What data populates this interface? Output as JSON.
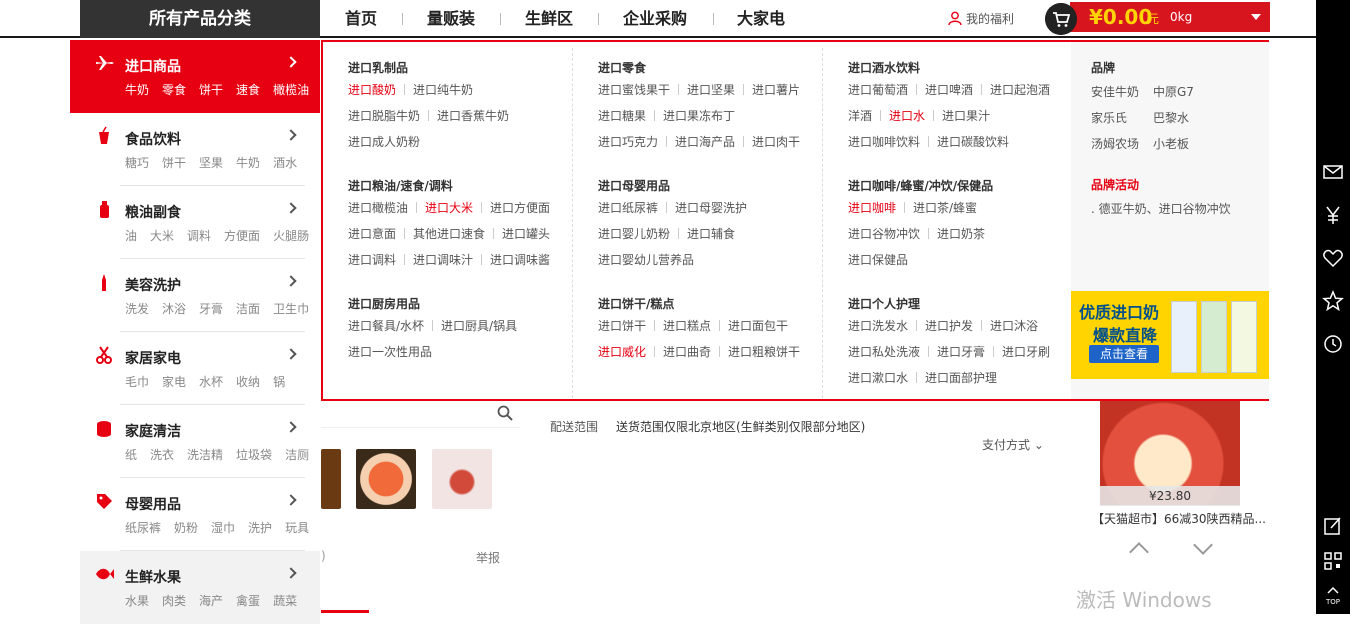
{
  "topnav": {
    "all_categories": "所有产品分类",
    "links": [
      "首页",
      "量贩装",
      "生鲜区",
      "企业采购",
      "大家电"
    ],
    "welfare": "我的福利",
    "cart_price": "¥0.00",
    "cart_unit": "元",
    "cart_weight": "0kg"
  },
  "categories": [
    {
      "title": "进口商品",
      "icon": "airplane-icon",
      "subs": [
        "牛奶",
        "零食",
        "饼干",
        "速食",
        "橄榄油"
      ]
    },
    {
      "title": "食品饮料",
      "icon": "cup-icon",
      "subs": [
        "糖巧",
        "饼干",
        "坚果",
        "牛奶",
        "酒水"
      ]
    },
    {
      "title": "粮油副食",
      "icon": "oil-bottle-icon",
      "subs": [
        "油",
        "大米",
        "调料",
        "方便面",
        "火腿肠"
      ]
    },
    {
      "title": "美容洗护",
      "icon": "lipstick-icon",
      "subs": [
        "洗发",
        "沐浴",
        "牙膏",
        "洁面",
        "卫生巾"
      ]
    },
    {
      "title": "家居家电",
      "icon": "scissors-icon",
      "subs": [
        "毛巾",
        "家电",
        "水杯",
        "收纳",
        "锅"
      ]
    },
    {
      "title": "家庭清洁",
      "icon": "tissue-roll-icon",
      "subs": [
        "纸",
        "洗衣",
        "洗洁精",
        "垃圾袋",
        "洁厕"
      ]
    },
    {
      "title": "母婴用品",
      "icon": "tag-icon",
      "subs": [
        "纸尿裤",
        "奶粉",
        "湿巾",
        "洗护",
        "玩具"
      ]
    },
    {
      "title": "生鲜水果",
      "icon": "fish-icon",
      "subs": [
        "水果",
        "肉类",
        "海产",
        "禽蛋",
        "蔬菜"
      ]
    }
  ],
  "panel": {
    "col1": [
      {
        "title": "进口乳制品",
        "rows": [
          [
            "进口酸奶",
            "进口纯牛奶"
          ],
          [
            "进口脱脂牛奶",
            "进口香蕉牛奶"
          ],
          [
            "进口成人奶粉"
          ]
        ]
      },
      {
        "title": "进口粮油/速食/调料",
        "rows": [
          [
            "进口橄榄油",
            "进口大米",
            "进口方便面"
          ],
          [
            "进口意面",
            "其他进口速食",
            "进口罐头"
          ],
          [
            "进口调料",
            "进口调味汁",
            "进口调味酱"
          ]
        ]
      },
      {
        "title": "进口厨房用品",
        "rows": [
          [
            "进口餐具/水杯",
            "进口厨具/锅具"
          ],
          [
            "进口一次性用品"
          ]
        ]
      }
    ],
    "col2": [
      {
        "title": "进口零食",
        "rows": [
          [
            "进口蜜饯果干",
            "进口坚果",
            "进口薯片"
          ],
          [
            "进口糖果",
            "进口果冻布丁"
          ],
          [
            "进口巧克力",
            "进口海产品",
            "进口肉干"
          ]
        ]
      },
      {
        "title": "进口母婴用品",
        "rows": [
          [
            "进口纸尿裤",
            "进口母婴洗护"
          ],
          [
            "进口婴儿奶粉",
            "进口辅食"
          ],
          [
            "进口婴幼儿营养品"
          ]
        ]
      },
      {
        "title": "进口饼干/糕点",
        "rows": [
          [
            "进口饼干",
            "进口糕点",
            "进口面包干"
          ],
          [
            "进口威化",
            "进口曲奇",
            "进口粗粮饼干"
          ]
        ]
      }
    ],
    "col3": [
      {
        "title": "进口酒水饮料",
        "rows": [
          [
            "进口葡萄酒",
            "进口啤酒",
            "进口起泡酒"
          ],
          [
            "洋酒",
            "进口水",
            "进口果汁"
          ],
          [
            "进口咖啡饮料",
            "进口碳酸饮料"
          ]
        ]
      },
      {
        "title": "进口咖啡/蜂蜜/冲饮/保健品",
        "rows": [
          [
            "进口咖啡",
            "进口茶/蜂蜜"
          ],
          [
            "进口谷物冲饮",
            "进口奶茶"
          ],
          [
            "进口保健品"
          ]
        ]
      },
      {
        "title": "进口个人护理",
        "rows": [
          [
            "进口洗发水",
            "进口护发",
            "进口沐浴"
          ],
          [
            "进口私处洗液",
            "进口牙膏",
            "进口牙刷"
          ],
          [
            "进口漱口水",
            "进口面部护理"
          ]
        ]
      }
    ],
    "highlighted": [
      "进口酸奶",
      "进口大米",
      "进口威化",
      "进口水",
      "进口咖啡"
    ],
    "brand_title": "品牌",
    "brands": [
      [
        "安佳牛奶",
        "中原G7"
      ],
      [
        "家乐氏",
        "巴黎水"
      ],
      [
        "汤姆农场",
        "小老板"
      ]
    ],
    "activity_title": "品牌活动",
    "activity": ". 德亚牛奶、进口谷物冲饮",
    "promo": {
      "line1": "优质进口奶",
      "line2": "爆款直降",
      "button": "点击查看"
    }
  },
  "behind": {
    "delivery_label": "配送范围",
    "delivery_text": "送货范围仅限北京地区(生鲜类别仅限部分地区)",
    "payment": "支付方式",
    "report": "举报",
    "paren": ")",
    "apple_price": "¥23.80",
    "apple_title": "【天猫超市】66减30陕西精品...",
    "watermark": "激活 Windows"
  },
  "colors": {
    "accent": "#e60012",
    "cart": "#d7151f",
    "price": "#ffd400"
  }
}
